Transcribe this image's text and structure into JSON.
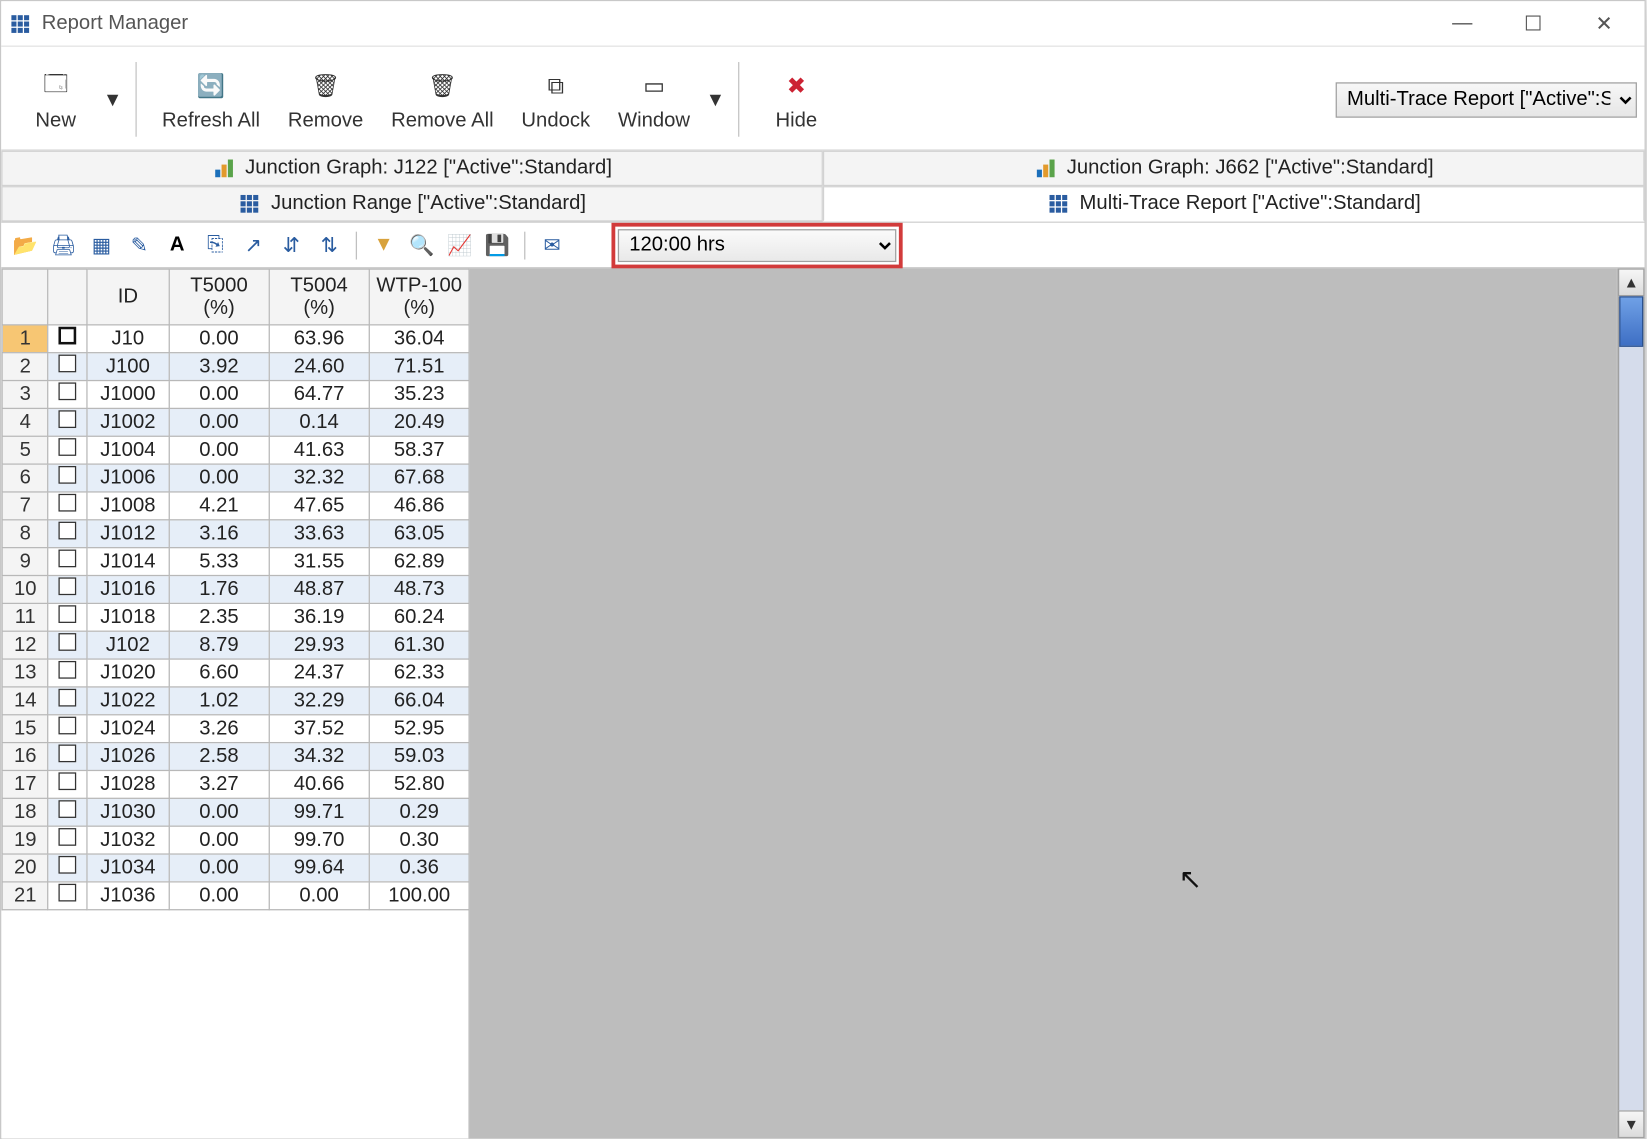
{
  "window": {
    "title": "Report Manager"
  },
  "toolbar": {
    "new": "New",
    "refresh_all": "Refresh All",
    "remove": "Remove",
    "remove_all": "Remove All",
    "undock": "Undock",
    "window": "Window",
    "hide": "Hide",
    "report_selector": "Multi-Trace Report [\"Active\":Sta"
  },
  "tabs": {
    "left_top": "Junction Graph: J122 [\"Active\":Standard]",
    "left_bot": "Junction Range [\"Active\":Standard]",
    "right_top": "Junction Graph: J662 [\"Active\":Standard]",
    "right_bot": "Multi-Trace Report [\"Active\":Standard]"
  },
  "time_selector": "120:00 hrs",
  "columns": [
    "ID",
    "T5000\n(%)",
    "T5004\n(%)",
    "WTP-100\n(%)"
  ],
  "rows": [
    {
      "n": 1,
      "id": "J10",
      "a": "0.00",
      "b": "63.96",
      "c": "36.04"
    },
    {
      "n": 2,
      "id": "J100",
      "a": "3.92",
      "b": "24.60",
      "c": "71.51"
    },
    {
      "n": 3,
      "id": "J1000",
      "a": "0.00",
      "b": "64.77",
      "c": "35.23"
    },
    {
      "n": 4,
      "id": "J1002",
      "a": "0.00",
      "b": "0.14",
      "c": "20.49"
    },
    {
      "n": 5,
      "id": "J1004",
      "a": "0.00",
      "b": "41.63",
      "c": "58.37"
    },
    {
      "n": 6,
      "id": "J1006",
      "a": "0.00",
      "b": "32.32",
      "c": "67.68"
    },
    {
      "n": 7,
      "id": "J1008",
      "a": "4.21",
      "b": "47.65",
      "c": "46.86"
    },
    {
      "n": 8,
      "id": "J1012",
      "a": "3.16",
      "b": "33.63",
      "c": "63.05"
    },
    {
      "n": 9,
      "id": "J1014",
      "a": "5.33",
      "b": "31.55",
      "c": "62.89"
    },
    {
      "n": 10,
      "id": "J1016",
      "a": "1.76",
      "b": "48.87",
      "c": "48.73"
    },
    {
      "n": 11,
      "id": "J1018",
      "a": "2.35",
      "b": "36.19",
      "c": "60.24"
    },
    {
      "n": 12,
      "id": "J102",
      "a": "8.79",
      "b": "29.93",
      "c": "61.30"
    },
    {
      "n": 13,
      "id": "J1020",
      "a": "6.60",
      "b": "24.37",
      "c": "62.33"
    },
    {
      "n": 14,
      "id": "J1022",
      "a": "1.02",
      "b": "32.29",
      "c": "66.04"
    },
    {
      "n": 15,
      "id": "J1024",
      "a": "3.26",
      "b": "37.52",
      "c": "52.95"
    },
    {
      "n": 16,
      "id": "J1026",
      "a": "2.58",
      "b": "34.32",
      "c": "59.03"
    },
    {
      "n": 17,
      "id": "J1028",
      "a": "3.27",
      "b": "40.66",
      "c": "52.80"
    },
    {
      "n": 18,
      "id": "J1030",
      "a": "0.00",
      "b": "99.71",
      "c": "0.29"
    },
    {
      "n": 19,
      "id": "J1032",
      "a": "0.00",
      "b": "99.70",
      "c": "0.30"
    },
    {
      "n": 20,
      "id": "J1034",
      "a": "0.00",
      "b": "99.64",
      "c": "0.36"
    },
    {
      "n": 21,
      "id": "J1036",
      "a": "0.00",
      "b": "0.00",
      "c": "100.00"
    }
  ]
}
